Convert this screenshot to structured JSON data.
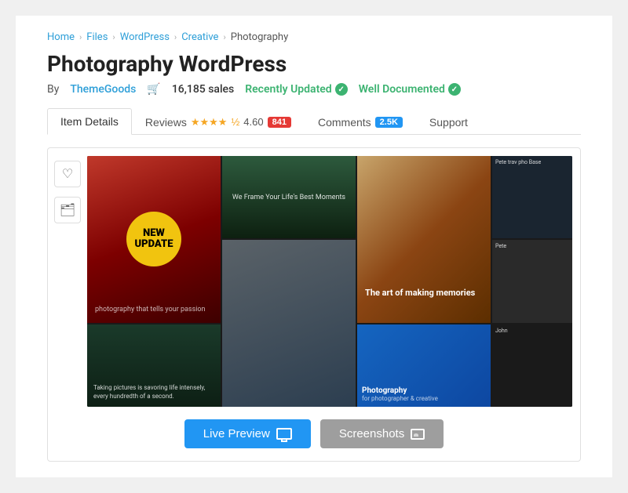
{
  "breadcrumb": {
    "items": [
      {
        "label": "Home",
        "href": "#"
      },
      {
        "label": "Files",
        "href": "#"
      },
      {
        "label": "WordPress",
        "href": "#"
      },
      {
        "label": "Creative",
        "href": "#"
      },
      {
        "label": "Photography",
        "href": "#"
      }
    ]
  },
  "page": {
    "title": "Photography WordPress",
    "author_label": "By",
    "author_name": "ThemeGoods",
    "sales_count": "16,185 sales",
    "recently_updated": "Recently Updated",
    "well_documented": "Well Documented"
  },
  "tabs": [
    {
      "id": "item-details",
      "label": "Item Details",
      "active": true
    },
    {
      "id": "reviews",
      "label": "Reviews",
      "active": false
    },
    {
      "id": "comments",
      "label": "Comments",
      "active": false
    },
    {
      "id": "support",
      "label": "Support",
      "active": false
    }
  ],
  "reviews": {
    "rating": "4.60",
    "count": "841"
  },
  "comments": {
    "count": "2.5K"
  },
  "preview": {
    "new_update_line1": "NEW",
    "new_update_line2": "UPDATE",
    "tagline": "photography that tells your passion",
    "frame_text": "We Frame Your Life's Best Moments",
    "photography_italic": "photography",
    "art_text": "The art of making memories",
    "bottom_text": "Photography",
    "bottom_sub": "for photographer & creative",
    "taking_pictures": "Taking pictures is savoring life intensely, every hundredth of a second.",
    "col4_row1": "Pete trav pho Base",
    "col4_row2": "Pete",
    "col4_row3": "John"
  },
  "buttons": {
    "live_preview": "Live Preview",
    "screenshots": "Screenshots"
  },
  "sidebar": {
    "wishlist_label": "wishlist",
    "folder_label": "folder"
  },
  "colors": {
    "blue": "#2196f3",
    "green": "#3cb371",
    "red_badge": "#e53935",
    "blue_badge": "#2196f3",
    "author": "#2e9fd8"
  }
}
